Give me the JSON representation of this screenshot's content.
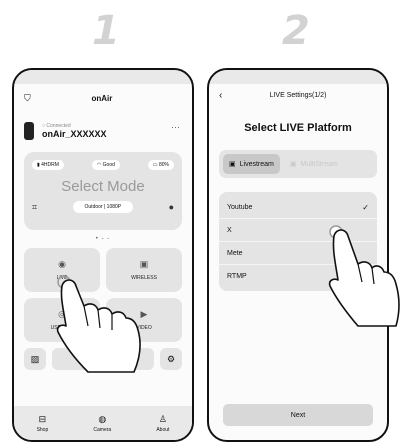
{
  "steps": [
    "1",
    "2"
  ],
  "phone1": {
    "title": "onAir",
    "device": {
      "status": "Connected",
      "name": "onAir_XXXXXX",
      "more": "···"
    },
    "badges": [
      "4HDRM",
      "Good",
      "80%"
    ],
    "mode": {
      "label": "Select Mode",
      "setting": "Outdoor | 1080P"
    },
    "page_dots": "• - -",
    "tiles": [
      {
        "label": "LIVE",
        "icon": "live-icon"
      },
      {
        "label": "WIRELESS",
        "icon": "wireless-icon"
      },
      {
        "label": "USB CAM",
        "icon": "usb-camera-icon"
      },
      {
        "label": "VIDEO",
        "icon": "video-icon"
      }
    ],
    "util_label": "P",
    "tabs": [
      {
        "label": "Shop",
        "icon": "shop-icon"
      },
      {
        "label": "Camera",
        "icon": "camera-icon"
      },
      {
        "label": "About",
        "icon": "about-icon"
      }
    ]
  },
  "phone2": {
    "title": "LIVE Settings(1/2)",
    "heading": "Select LIVE Platform",
    "platform_tabs": [
      {
        "label": "Livestream",
        "active": true
      },
      {
        "label": "MultiStream",
        "active": false
      }
    ],
    "platforms": [
      "Youtube",
      "X",
      "Mete",
      "RTMP"
    ],
    "selected": "Youtube",
    "next_label": "Next"
  }
}
